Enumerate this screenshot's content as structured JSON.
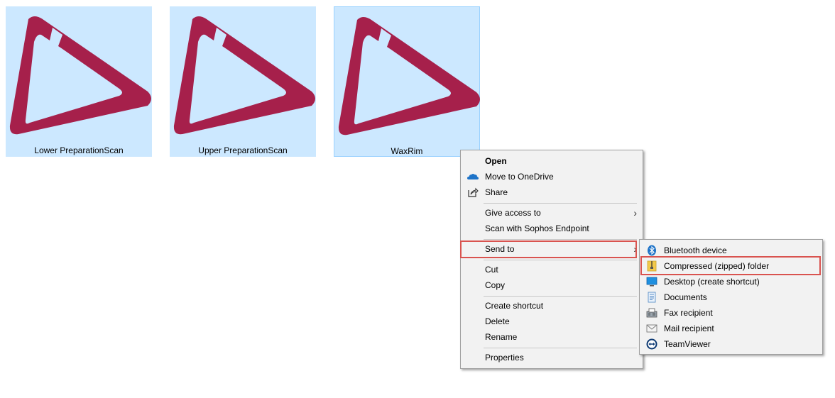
{
  "files": [
    {
      "name": "Lower PreparationScan",
      "icon": "3d-scan-logo-icon",
      "selected": false
    },
    {
      "name": "Upper PreparationScan",
      "icon": "3d-scan-logo-icon",
      "selected": false
    },
    {
      "name": "WaxRim",
      "icon": "3d-scan-logo-icon",
      "selected": true
    }
  ],
  "context_menu": {
    "open": "Open",
    "move_to_onedrive": "Move to OneDrive",
    "share": "Share",
    "give_access_to": "Give access to",
    "scan_sophos": "Scan with Sophos Endpoint",
    "send_to": "Send to",
    "cut": "Cut",
    "copy": "Copy",
    "create_shortcut": "Create shortcut",
    "delete": "Delete",
    "rename": "Rename",
    "properties": "Properties"
  },
  "send_to_menu": {
    "bluetooth": "Bluetooth device",
    "compressed": "Compressed (zipped) folder",
    "desktop": "Desktop (create shortcut)",
    "documents": "Documents",
    "fax": "Fax recipient",
    "mail": "Mail recipient",
    "teamviewer": "TeamViewer"
  },
  "colors": {
    "logo": "#a6204b",
    "selection": "#cce8ff",
    "highlight_box": "#d9534f",
    "menu_bg": "#f2f2f2"
  }
}
